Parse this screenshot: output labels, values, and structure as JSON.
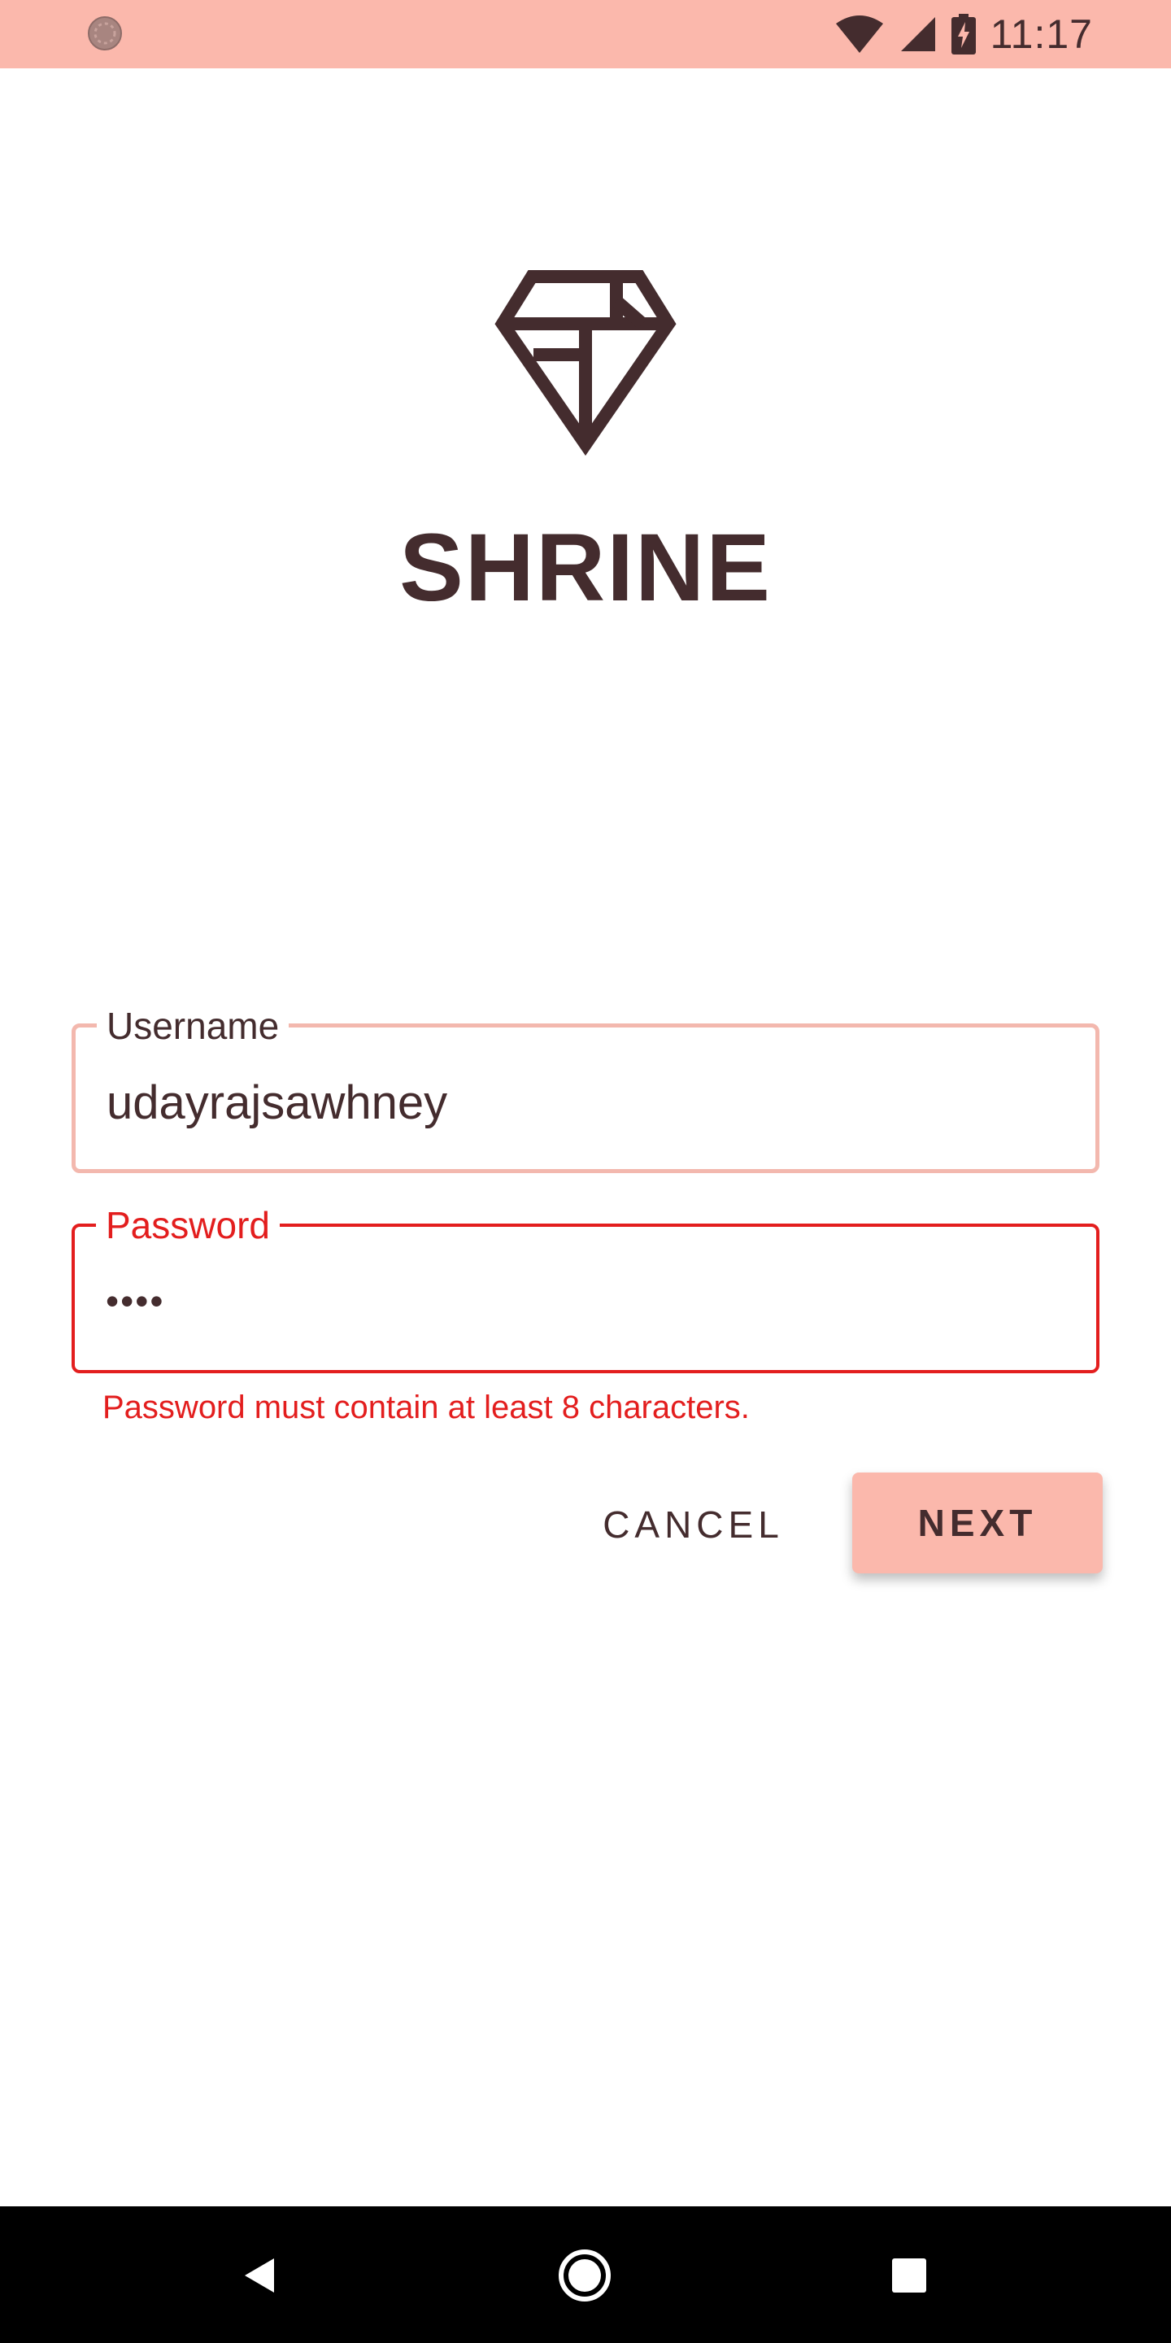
{
  "status_bar": {
    "time": "11:17",
    "background_color": "#fbb8ac",
    "icons": [
      "loading-indicator-icon",
      "wifi-icon",
      "cell-signal-icon",
      "battery-charging-icon"
    ]
  },
  "app": {
    "title": "SHRINE",
    "logo_icon": "diamond-icon",
    "text_color": "#442c2e",
    "accent_color": "#fbb8ac",
    "error_color": "#e31e1e"
  },
  "form": {
    "username": {
      "label": "Username",
      "value": "udayrajsawhney"
    },
    "password": {
      "label": "Password",
      "value": "••••",
      "error": "Password must contain at least 8 characters."
    }
  },
  "actions": {
    "cancel_label": "CANCEL",
    "next_label": "NEXT"
  },
  "nav_bar": {
    "icons": [
      "back-icon",
      "home-icon",
      "recents-icon"
    ]
  }
}
